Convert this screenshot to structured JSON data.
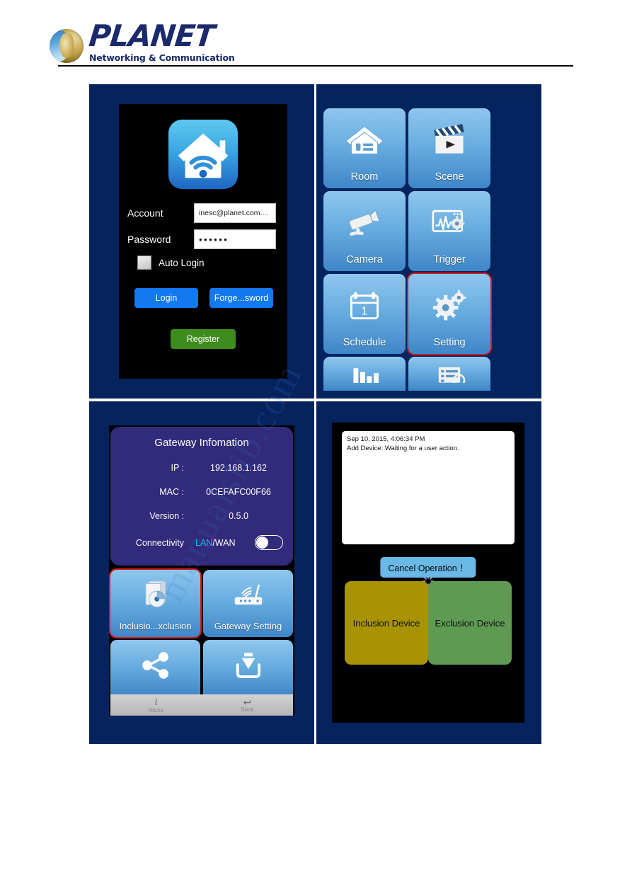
{
  "brand": {
    "name": "PLANET",
    "tagline": "Networking & Communication",
    "logo_icon": "planet-globe-logo"
  },
  "watermark_text": "manualslib.com",
  "colors": {
    "panel_bg": "#06235e",
    "tile_blue": "#69aee0",
    "accent_red": "#d81a1a",
    "login_btn_blue": "#1478f0",
    "register_green": "#3e8c1e",
    "gateway_card": "#322a7a",
    "lan_highlight": "#22b7f0",
    "inclusion_yellow": "#a79303",
    "exclusion_green": "#5f9a52",
    "cancel_blue": "#69b8e6"
  },
  "login_screen": {
    "app_icon": "home-wifi-app-icon",
    "account": {
      "label": "Account",
      "value": "inesc@planet.com....",
      "placeholder": "Account"
    },
    "password": {
      "label": "Password",
      "value": "••••••",
      "placeholder": "Password"
    },
    "auto_login": {
      "label": "Auto Login",
      "checked": false
    },
    "login_button": "Login",
    "forgot_button": "Forge...sword",
    "register_button": "Register"
  },
  "menu_screen": {
    "tiles": [
      {
        "label": "Room",
        "icon": "house-icon",
        "selected": false
      },
      {
        "label": "Scene",
        "icon": "clapperboard-icon",
        "selected": false
      },
      {
        "label": "Camera",
        "icon": "cctv-camera-icon",
        "selected": false
      },
      {
        "label": "Trigger",
        "icon": "waveform-gear-icon",
        "selected": false
      },
      {
        "label": "Schedule",
        "icon": "calendar-1-icon",
        "selected": false
      },
      {
        "label": "Setting",
        "icon": "gears-icon",
        "selected": true
      },
      {
        "label": "",
        "icon": "bar-chart-icon",
        "selected": false
      },
      {
        "label": "",
        "icon": "log-list-icon",
        "selected": false
      }
    ]
  },
  "gateway_screen": {
    "card_title": "Gateway Infomation",
    "rows": [
      {
        "key": "IP :",
        "value": "192.168.1.162"
      },
      {
        "key": "MAC :",
        "value": "0CEFAFC00F66"
      },
      {
        "key": "Version :",
        "value": "0.5.0"
      }
    ],
    "connectivity": {
      "key": "Connectivity",
      "value_highlight": "LAN",
      "value_rest": "/WAN",
      "toggle_on": false
    },
    "tiles": [
      {
        "label": "Inclusio...xclusion",
        "icon": "disc-install-icon",
        "selected": true
      },
      {
        "label": "Gateway Setting",
        "icon": "wifi-router-icon",
        "selected": false
      },
      {
        "label": "",
        "icon": "share-nodes-icon",
        "selected": false
      },
      {
        "label": "",
        "icon": "download-tray-icon",
        "selected": false
      }
    ],
    "tabbar": [
      {
        "label": "About",
        "icon": "info-i-icon"
      },
      {
        "label": "Back",
        "icon": "back-arrow-icon"
      }
    ]
  },
  "add_device_screen": {
    "log_lines": [
      "Sep 10, 2015, 4:06:34 PM",
      "Add Device: Waiting for a user action."
    ],
    "cancel_button": "Cancel Operation ！",
    "spinner_icon": "loading-spinner-icon",
    "inclusion_button": "Inclusion Device",
    "exclusion_button": "Exclusion Device"
  }
}
